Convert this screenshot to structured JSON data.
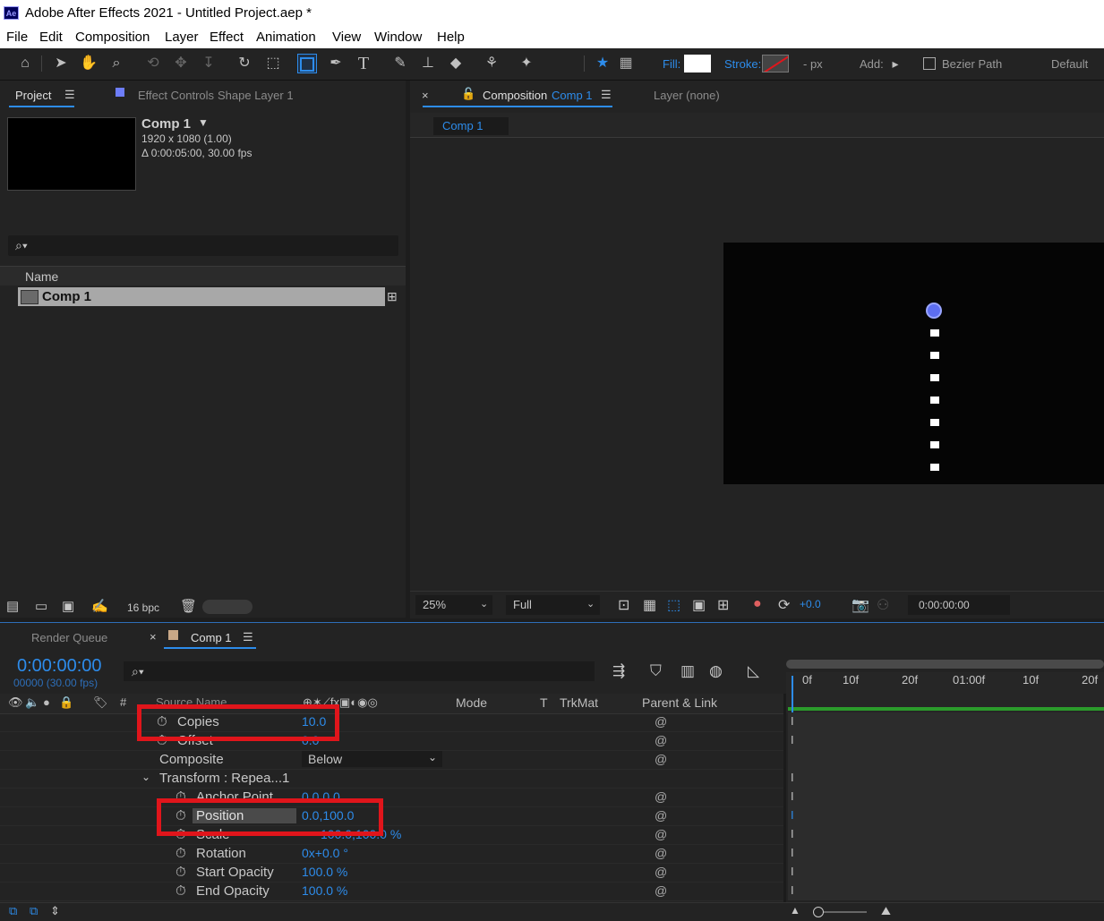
{
  "app": {
    "title": "Adobe After Effects 2021 - Untitled Project.aep *",
    "logo": "Ae"
  },
  "menu": [
    "File",
    "Edit",
    "Composition",
    "Layer",
    "Effect",
    "Animation",
    "View",
    "Window",
    "Help"
  ],
  "toolbar": {
    "fill_label": "Fill:",
    "stroke_label": "Stroke:",
    "stroke_width": "- px",
    "add_label": "Add:",
    "bezier_label": "Bezier Path",
    "workspace": "Default"
  },
  "project_panel": {
    "tab_project": "Project",
    "tab_effect_controls": "Effect Controls",
    "effect_controls_layer": "Shape Layer 1",
    "comp_name": "Comp 1",
    "comp_size": "1920 x 1080 (1.00)",
    "comp_duration": "Δ 0:00:05:00, 30.00 fps",
    "column_name": "Name",
    "items": [
      {
        "name": "Comp 1"
      }
    ],
    "bpc": "16 bpc"
  },
  "composition_panel": {
    "tab_label": "Composition",
    "tab_comp": "Comp 1",
    "layer_tab": "Layer (none)",
    "breadcrumb": "Comp 1",
    "zoom": "25%",
    "resolution": "Full",
    "exposure": "+0.0",
    "timecode": "0:00:00:00"
  },
  "timeline_panel": {
    "tab_render_queue": "Render Queue",
    "tab_comp": "Comp 1",
    "current_time": "0:00:00:00",
    "frame_info": "00000 (30.00 fps)",
    "columns": {
      "number": "#",
      "source_name": "Source Name",
      "mode": "Mode",
      "t": "T",
      "trkmat": "TrkMat",
      "parent": "Parent & Link"
    },
    "ruler": [
      "0f",
      "10f",
      "20f",
      "01:00f",
      "10f",
      "20f"
    ],
    "properties": [
      {
        "label": "Copies",
        "value": "10.0"
      },
      {
        "label": "Offset",
        "value": "0.0"
      },
      {
        "label": "Composite",
        "value": "Below"
      },
      {
        "label": "Transform : Repea...1",
        "value": ""
      },
      {
        "label": "Anchor Point",
        "value": "0.0,0.0"
      },
      {
        "label": "Position",
        "value": "0.0,100.0"
      },
      {
        "label": "Scale",
        "value": "100.0,100.0 %"
      },
      {
        "label": "Rotation",
        "value": "0x+0.0 °"
      },
      {
        "label": "Start Opacity",
        "value": "100.0 %"
      },
      {
        "label": "End Opacity",
        "value": "100.0 %"
      }
    ]
  }
}
